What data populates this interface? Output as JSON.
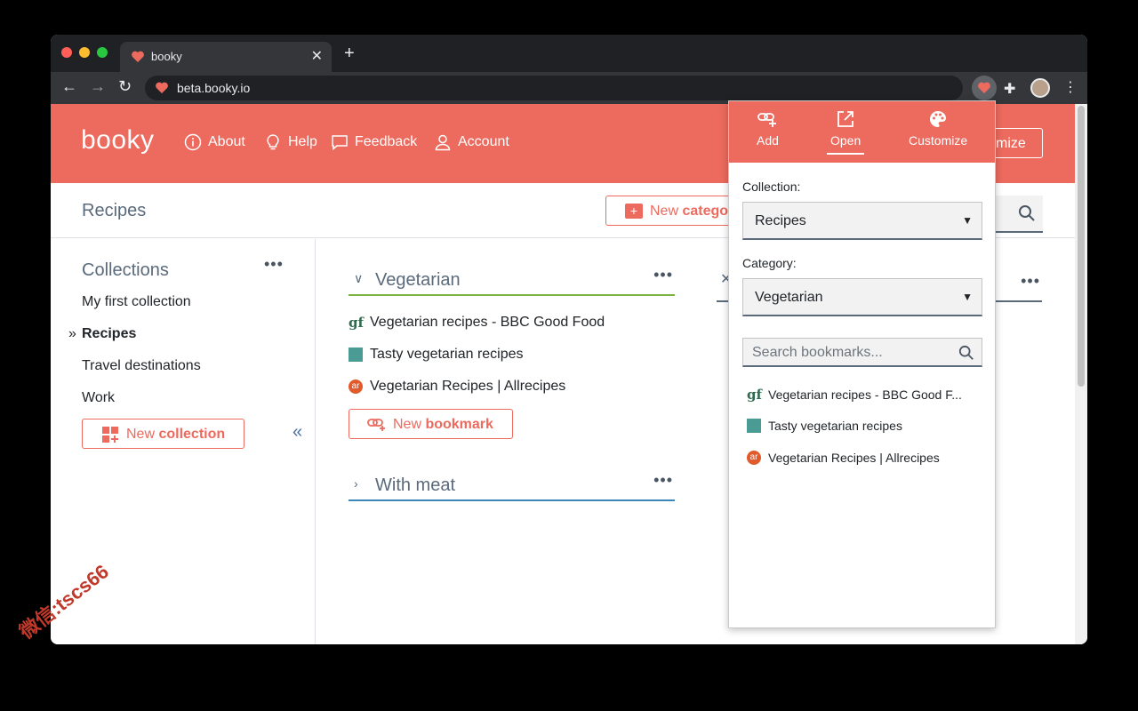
{
  "browser": {
    "tab_title": "booky",
    "url": "beta.booky.io"
  },
  "header": {
    "logo": "booky",
    "nav": [
      {
        "label": "About",
        "icon": "info-icon"
      },
      {
        "label": "Help",
        "icon": "lightbulb-icon"
      },
      {
        "label": "Feedback",
        "icon": "chat-icon"
      },
      {
        "label": "Account",
        "icon": "user-icon"
      }
    ],
    "customize_label": "mize"
  },
  "subheader": {
    "title": "Recipes",
    "new_category_prefix": "New ",
    "new_category_bold": "catego"
  },
  "sidebar": {
    "title": "Collections",
    "arrow": "»",
    "items": [
      "My first collection",
      "Recipes",
      "Travel destinations",
      "Work"
    ],
    "new_collection_prefix": "New ",
    "new_collection_bold": "collection"
  },
  "main": {
    "categories": [
      {
        "name": "Vegetarian",
        "bookmarks": [
          {
            "label": "Vegetarian recipes - BBC Good Food",
            "icon": "bbc-good-food-icon"
          },
          {
            "label": "Tasty vegetarian recipes",
            "icon": "jamie-oliver-icon"
          },
          {
            "label": "Vegetarian Recipes | Allrecipes",
            "icon": "allrecipes-icon"
          }
        ]
      },
      {
        "name": "With meat",
        "bookmarks": []
      }
    ],
    "new_bookmark_prefix": "New ",
    "new_bookmark_bold": "bookmark"
  },
  "popup": {
    "tabs": [
      {
        "label": "Add",
        "icon": "add-link-icon"
      },
      {
        "label": "Open",
        "icon": "open-external-icon"
      },
      {
        "label": "Customize",
        "icon": "palette-icon"
      }
    ],
    "collection_label": "Collection:",
    "collection_value": "Recipes",
    "category_label": "Category:",
    "category_value": "Vegetarian",
    "search_placeholder": "Search bookmarks...",
    "bookmarks": [
      {
        "label": "Vegetarian recipes - BBC Good F...",
        "icon": "bbc-good-food-icon"
      },
      {
        "label": "Tasty vegetarian recipes",
        "icon": "jamie-oliver-icon"
      },
      {
        "label": "Vegetarian Recipes | Allrecipes",
        "icon": "allrecipes-icon"
      }
    ]
  },
  "colors": {
    "brand": "#ec6a5e",
    "text_muted": "#5a6a7b",
    "vegetarian_underline": "#7cb342",
    "meat_underline": "#3d87b8"
  },
  "watermark": "微信:tscs66"
}
